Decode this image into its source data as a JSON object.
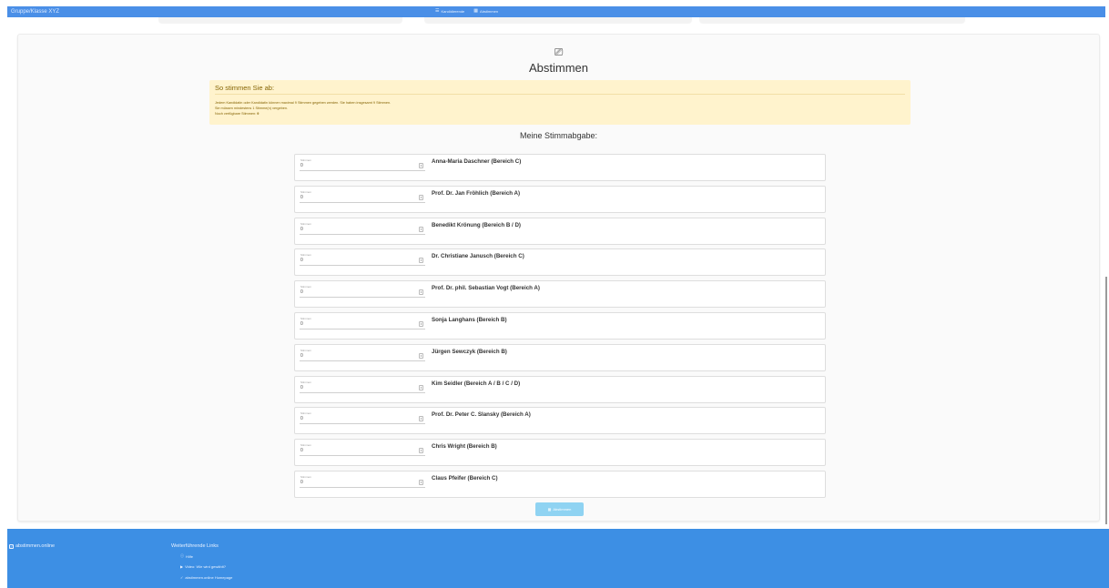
{
  "topbar": {
    "brand": "Gruppe/Klasse XYZ",
    "nav": [
      {
        "icon": "list-icon",
        "glyph": "☰",
        "label": "Kandidierende"
      },
      {
        "icon": "ballot-icon",
        "glyph": "▦",
        "label": "Abstimmen"
      }
    ]
  },
  "page": {
    "icon": "ballot-box-icon",
    "icon_glyph": "⎚",
    "title": "Abstimmen"
  },
  "info": {
    "title": "So stimmen Sie ab:",
    "line1": "Jedem Kandidatin oder Kandidatin können maximal 9 Stimmen gegeben werden. Sie haben insgesamt 9 Stimmen.",
    "line2": "Sie müssen mindestens 1 Stimme(n) vergeben.",
    "line3_label": "Noch verfügbare Stimmen:",
    "line3_value": "9"
  },
  "subheading": "Meine Stimmabgabe:",
  "field_label": "Stimmen",
  "candidates": [
    {
      "name": "Anna-Maria Daschner (Bereich C)",
      "votes": "0"
    },
    {
      "name": "Prof. Dr. Jan Fröhlich (Bereich A)",
      "votes": "0"
    },
    {
      "name": "Benedikt Krönung (Bereich B / D)",
      "votes": "0"
    },
    {
      "name": "Dr. Christiane Janusch (Bereich C)",
      "votes": "0"
    },
    {
      "name": "Prof. Dr. phil. Sebastian Vogt (Bereich A)",
      "votes": "0"
    },
    {
      "name": "Sonja Langhans (Bereich B)",
      "votes": "0"
    },
    {
      "name": "Jürgen Sewczyk (Bereich B)",
      "votes": "0"
    },
    {
      "name": "Kim Seidler (Bereich A / B / C / D)",
      "votes": "0"
    },
    {
      "name": "Prof. Dr. Peter C. Slansky (Bereich A)",
      "votes": "0"
    },
    {
      "name": "Chris Wright (Bereich B)",
      "votes": "0"
    },
    {
      "name": "Claus Pfeifer (Bereich C)",
      "votes": "0"
    }
  ],
  "submit": {
    "icon": "ballot-icon",
    "glyph": "▦",
    "label": "Abstimmen"
  },
  "footer": {
    "brand": "abstimmen.online",
    "links_title": "Weiterführende Links",
    "links": [
      {
        "icon": "info-icon",
        "glyph": "ⓘ",
        "label": "Hilfe"
      },
      {
        "icon": "video-icon",
        "glyph": "▶",
        "label": "Video: Wie wird gewählt?"
      },
      {
        "icon": "checkbox-icon",
        "glyph": "✓",
        "label": "abstimmen.online Homepage"
      }
    ]
  },
  "colors": {
    "primary": "#4a8fe7",
    "footer": "#3d8fe4",
    "info_bg": "#fff3cd",
    "info_text": "#856404",
    "submit": "#8fd3f2"
  }
}
